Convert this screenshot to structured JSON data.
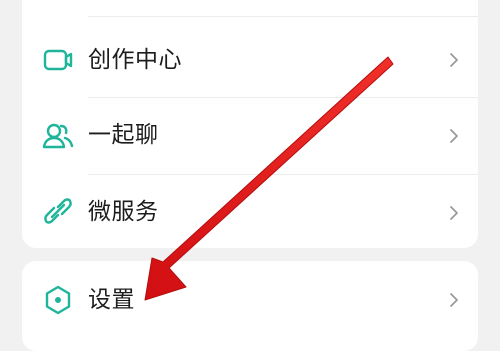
{
  "menu": {
    "items": [
      {
        "label": "创作中心",
        "icon": "video-camera-icon"
      },
      {
        "label": "一起聊",
        "icon": "users-icon"
      },
      {
        "label": "微服务",
        "icon": "link-icon"
      }
    ]
  },
  "settings_item": {
    "label": "设置",
    "icon": "settings-hexagon-icon"
  },
  "colors": {
    "accent": "#1fb59a",
    "arrow": "#e11b1b",
    "background": "#f1f1f1",
    "chevron": "#9a9a9a"
  }
}
